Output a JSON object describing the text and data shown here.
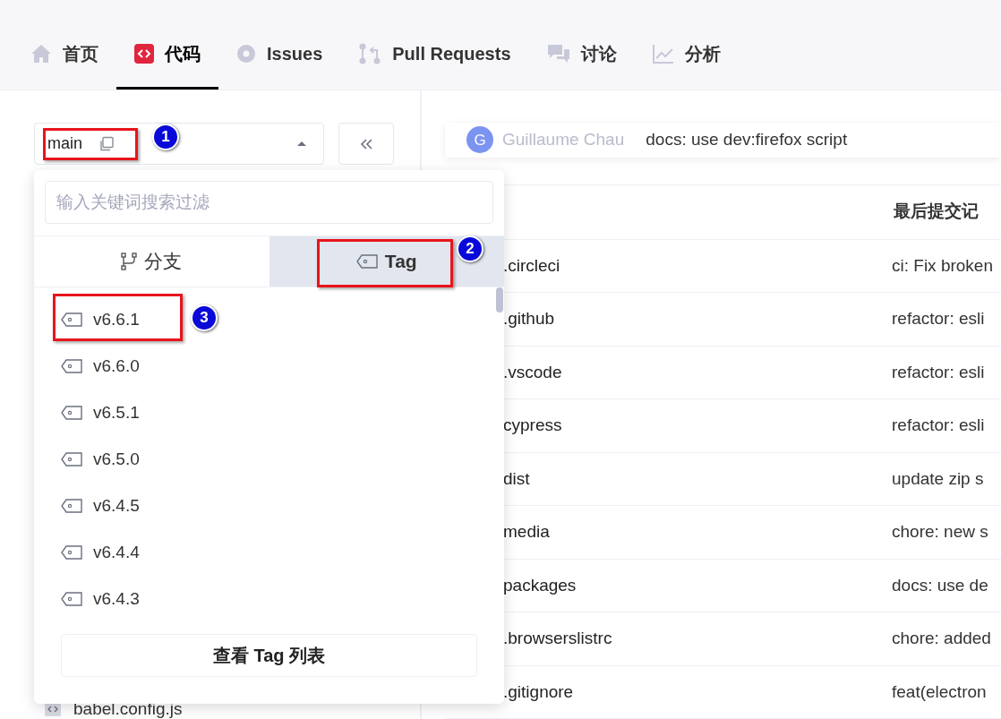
{
  "nav": {
    "tabs": [
      {
        "label": "首页",
        "selected": false
      },
      {
        "label": "代码",
        "selected": true
      },
      {
        "label": "Issues",
        "selected": false
      },
      {
        "label": "Pull Requests",
        "selected": false
      },
      {
        "label": "讨论",
        "selected": false
      },
      {
        "label": "分析",
        "selected": false
      }
    ]
  },
  "branch_selector": {
    "value": "main",
    "expanded": true
  },
  "dropdown": {
    "search": {
      "placeholder": "输入关键词搜索过滤"
    },
    "tabs": [
      {
        "label": "分支",
        "selected": false
      },
      {
        "label": "Tag",
        "selected": true
      }
    ],
    "items": [
      "v6.6.1",
      "v6.6.0",
      "v6.5.1",
      "v6.5.0",
      "v6.4.5",
      "v6.4.4",
      "v6.4.3"
    ],
    "footer_button": "查看 Tag 列表"
  },
  "file_tree": {
    "items": [
      "babel.config.js"
    ]
  },
  "commit": {
    "avatar": "G",
    "author": "Guillaume Chau",
    "message": "docs: use dev:firefox script"
  },
  "table": {
    "columns": [
      "最后提交记"
    ],
    "rows": [
      {
        "name": ".circleci",
        "commit": "ci: Fix broken"
      },
      {
        "name": ".github",
        "commit": "refactor: esli"
      },
      {
        "name": ".vscode",
        "commit": "refactor: esli"
      },
      {
        "name": "cypress",
        "commit": "refactor: esli"
      },
      {
        "name": "dist",
        "commit": "update zip s"
      },
      {
        "name": "media",
        "commit": "chore: new s"
      },
      {
        "name": "packages",
        "commit": "docs: use de"
      },
      {
        "name": ".browserslistrc",
        "commit": "chore: added"
      },
      {
        "name": ".gitignore",
        "commit": "feat(electron"
      }
    ]
  },
  "annotations": [
    {
      "number": "1"
    },
    {
      "number": "2"
    },
    {
      "number": "3"
    }
  ]
}
